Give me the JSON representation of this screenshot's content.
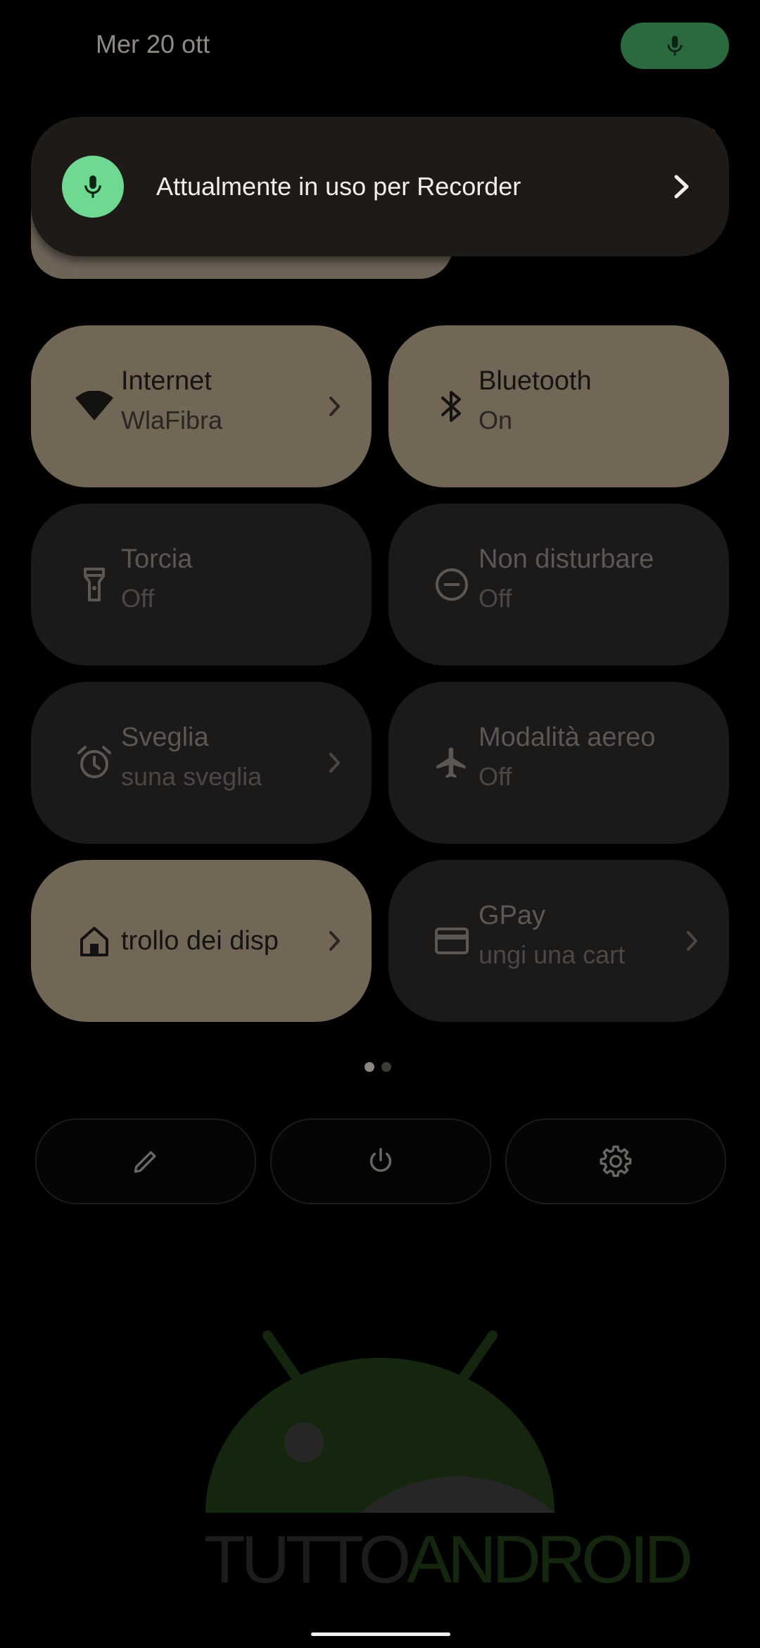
{
  "status": {
    "date": "Mer 20 ott"
  },
  "edge_glyph": "0",
  "privacy_popup": {
    "text": "Attualmente in uso per Recorder",
    "icon": "microphone-icon"
  },
  "tiles": [
    {
      "label": "Internet",
      "sub": "WlaFibra",
      "state": "on",
      "icon": "wifi-icon",
      "has_chevron": true
    },
    {
      "label": "Bluetooth",
      "sub": "On",
      "state": "on",
      "icon": "bluetooth-icon",
      "has_chevron": false
    },
    {
      "label": "Torcia",
      "sub": "Off",
      "state": "off",
      "icon": "flashlight-icon",
      "has_chevron": false
    },
    {
      "label": "Non disturbare",
      "sub": "Off",
      "state": "off",
      "icon": "do-not-disturb-icon",
      "has_chevron": false
    },
    {
      "label": "Sveglia",
      "sub": "suna sveglia",
      "state": "off",
      "icon": "alarm-icon",
      "has_chevron": true
    },
    {
      "label": "Modalità aereo",
      "sub": "Off",
      "state": "off",
      "icon": "airplane-icon",
      "has_chevron": false
    },
    {
      "label": "trollo dei disp",
      "sub": "",
      "state": "on",
      "icon": "home-icon",
      "has_chevron": true
    },
    {
      "label": "GPay",
      "sub": "ungi una cart",
      "state": "off",
      "icon": "card-icon",
      "has_chevron": true
    }
  ],
  "pager": {
    "pages": 2,
    "current": 1
  },
  "actions": [
    {
      "icon": "edit-pencil-icon"
    },
    {
      "icon": "power-icon"
    },
    {
      "icon": "settings-gear-icon"
    }
  ],
  "watermark": {
    "part1": "TUTTO",
    "part2": "ANDROID"
  },
  "colors": {
    "tile_on": "#726656",
    "tile_off": "#1b1a18",
    "mic_green": "#6fd992",
    "pill_green": "#2b6a3e"
  }
}
